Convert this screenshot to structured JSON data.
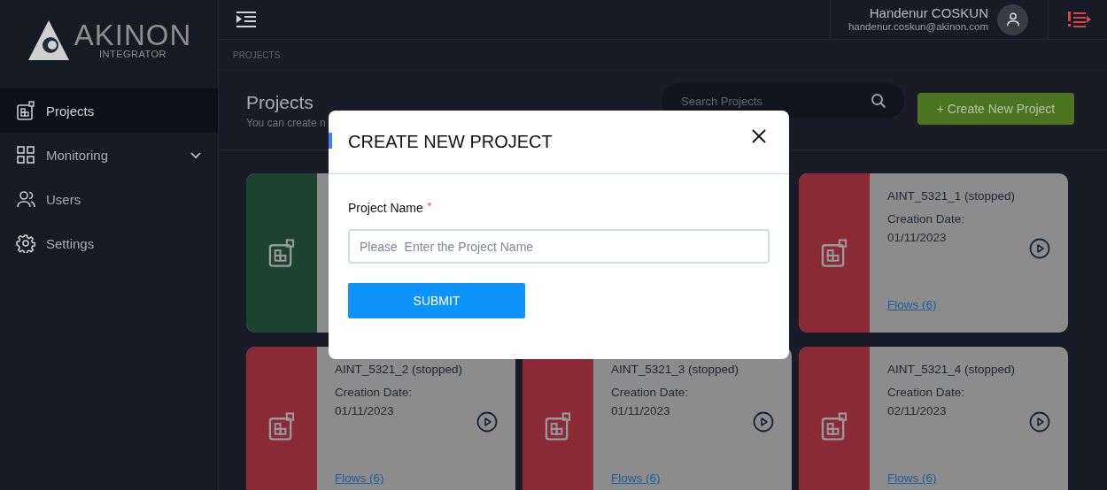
{
  "sidebar": {
    "logo": {
      "name": "AKINON",
      "subtitle": "INTEGRATOR"
    },
    "items": [
      {
        "label": "Projects",
        "kind": "projects",
        "selected": true
      },
      {
        "label": "Monitoring",
        "kind": "monitoring",
        "selected": false,
        "expanded": false
      },
      {
        "label": "Users",
        "kind": "users",
        "selected": false
      },
      {
        "label": "Settings",
        "kind": "settings",
        "selected": false
      }
    ]
  },
  "header": {
    "user_name": "Handenur COSKUN",
    "user_email": "handenur.coskun@akinon.com"
  },
  "breadcrumb": "PROJECTS",
  "page": {
    "title": "Projects",
    "subtitle": "You can create n",
    "search": {
      "placeholder": "Search Projects"
    },
    "create_button": "+ Create New Project"
  },
  "projects": [
    {
      "color": "#1b4330"
    },
    {
      "color": "#8a2a36",
      "name": "AINT_5321_1 (stopped)",
      "date_label": "Creation Date:",
      "date": "01/11/2023",
      "flows": "Flows (6)"
    },
    {
      "color": "#8a2a36",
      "name": "AINT_5321_2 (stopped)",
      "date_label": "Creation Date:",
      "date": "01/11/2023",
      "flows": "Flows (6)"
    },
    {
      "color": "#8a2a36",
      "name": "AINT_5321_3 (stopped)",
      "date_label": "Creation Date:",
      "date": "01/11/2023",
      "flows": "Flows (6)"
    },
    {
      "color": "#8a2a36",
      "name": "AINT_5321_4 (stopped)",
      "date_label": "Creation Date:",
      "date": "02/11/2023",
      "flows": "Flows (6)"
    }
  ],
  "modal": {
    "title": "CREATE NEW PROJECT",
    "field": {
      "label": "Project Name",
      "required_mark": "*",
      "placeholder": "Please  Enter the Project Name"
    },
    "submit": "SUBMIT"
  }
}
